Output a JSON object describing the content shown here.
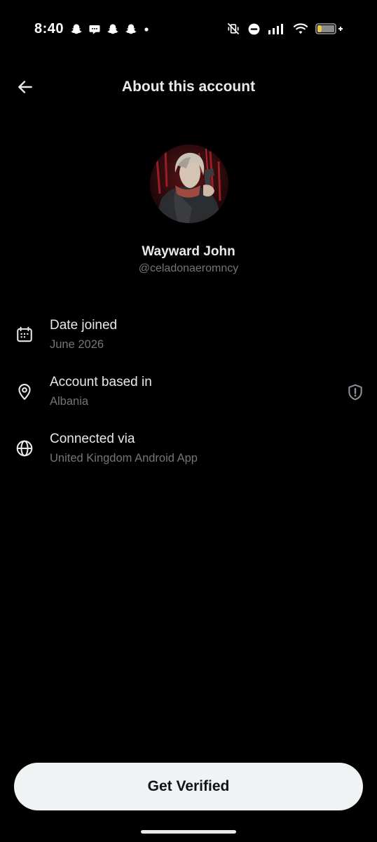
{
  "status_bar": {
    "time": "8:40",
    "notification_icons": [
      "snapchat-icon",
      "chat-bubble-icon",
      "snapchat-icon",
      "snapchat-icon",
      "dot-icon"
    ],
    "system_icons": [
      "vibrate-off-icon",
      "do-not-disturb-icon",
      "signal-icon",
      "wifi-icon",
      "battery-charging-icon"
    ]
  },
  "header": {
    "back_icon": "back-arrow-icon",
    "title": "About this account"
  },
  "profile": {
    "display_name": "Wayward John",
    "handle": "@celadonaeromncy"
  },
  "info_rows": [
    {
      "icon": "calendar-icon",
      "label": "Date joined",
      "value": "June 2026"
    },
    {
      "icon": "location-pin-icon",
      "label": "Account based in",
      "value": "Albania",
      "trailing_icon": "shield-alert-icon"
    },
    {
      "icon": "globe-icon",
      "label": "Connected via",
      "value": "United Kingdom Android App"
    }
  ],
  "verify_button": {
    "label": "Get Verified"
  },
  "colors": {
    "background": "#000000",
    "primary_text": "#e7e9ea",
    "secondary_text": "#71767b",
    "button_bg": "#eff3f4",
    "button_text": "#0f1419"
  }
}
